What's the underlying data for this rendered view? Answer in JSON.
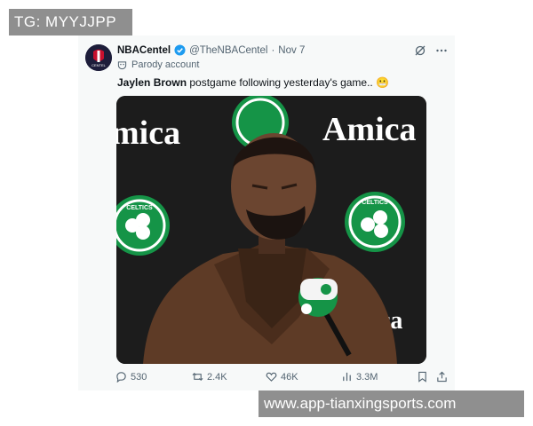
{
  "watermarks": {
    "top": "TG: MYYJJPP",
    "bottom": "www.app-tianxingsports.com"
  },
  "tweet": {
    "author_name": "NBACentel",
    "handle": "@TheNBACentel",
    "separator": "·",
    "date": "Nov 7",
    "label": "Parody account",
    "text_bold": "Jaylen Brown",
    "text_rest": " postgame following yesterday's game.. 😬",
    "avatar_text": "CENTEL"
  },
  "media": {
    "backdrop_left": "mica",
    "backdrop_right": "Amica",
    "backdrop_bottom": "ca",
    "logo_text": "CELTICS"
  },
  "actions": {
    "replies": "530",
    "reposts": "2.4K",
    "likes": "46K",
    "views": "3.3M"
  },
  "colors": {
    "celtics_green": "#159447",
    "verified_blue": "#1d9bf0",
    "text_muted": "#536471"
  }
}
